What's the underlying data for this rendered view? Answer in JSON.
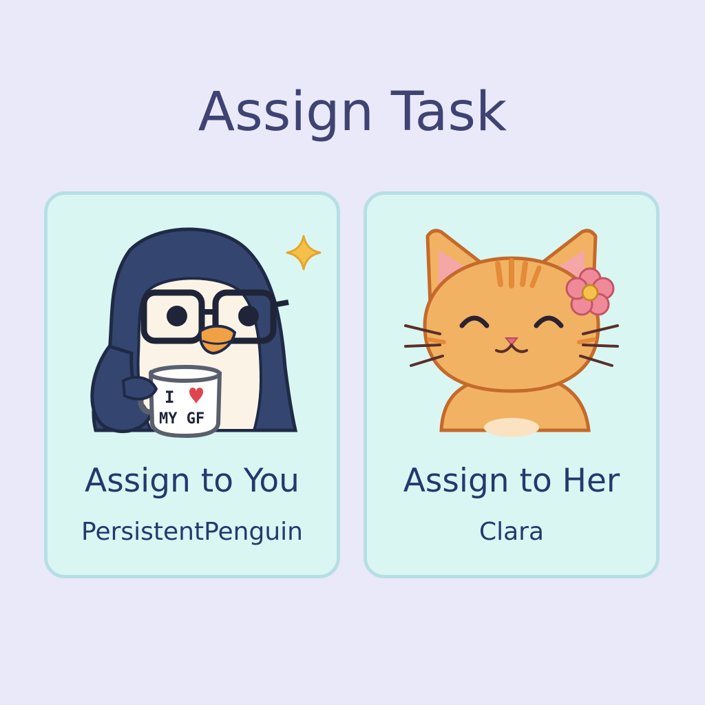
{
  "page": {
    "title": "Assign Task"
  },
  "options": [
    {
      "label": "Assign to You",
      "name": "PersistentPenguin",
      "avatar": "penguin-with-glasses-and-mug",
      "mug_line1": "I",
      "mug_line2": "MY GF"
    },
    {
      "label": "Assign to Her",
      "name": "Clara",
      "avatar": "orange-cat-with-flower"
    }
  ],
  "colors": {
    "background": "#eae9f9",
    "card_fill": "#d9f6f3",
    "card_border": "#b6dfe5",
    "text": "#26386d",
    "title": "#3f4373"
  }
}
